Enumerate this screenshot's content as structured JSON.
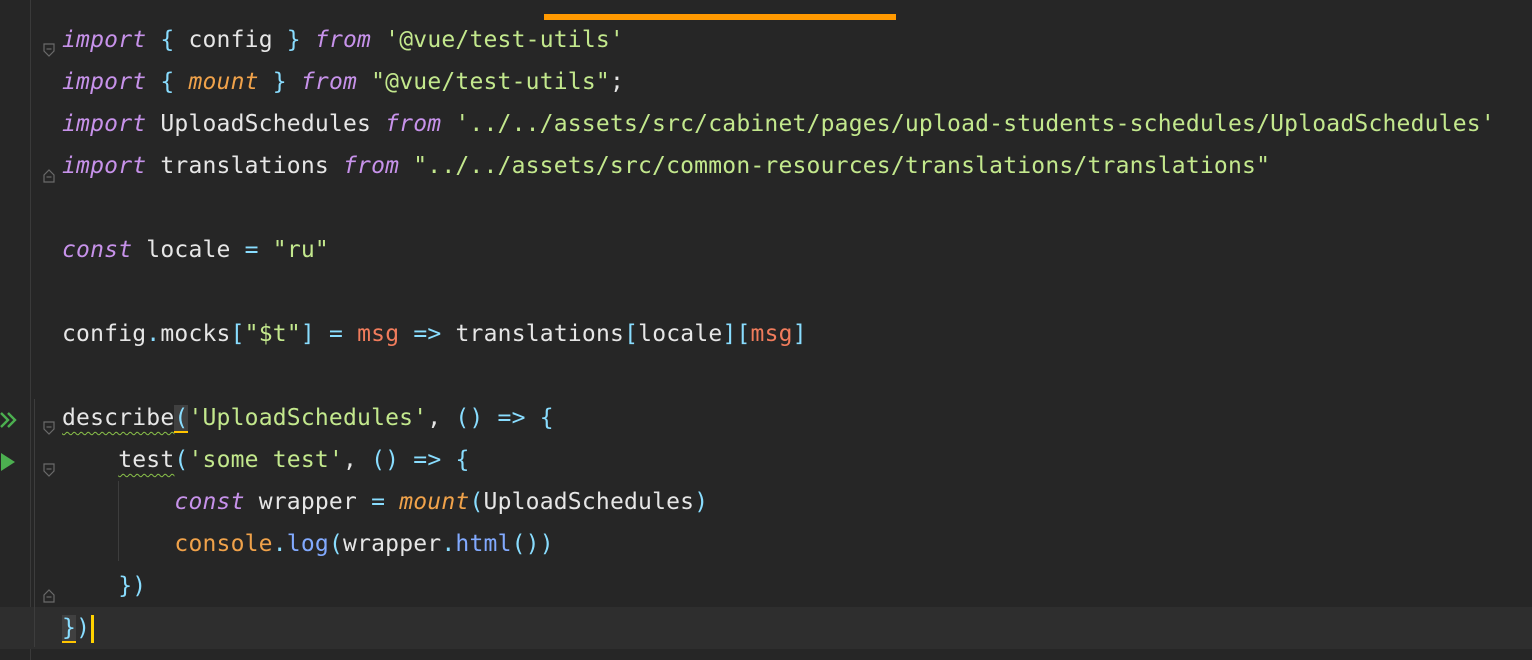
{
  "editor": {
    "language": "javascript",
    "lines": [
      {
        "tokens": [
          {
            "t": "import",
            "c": "kw"
          },
          {
            "t": " { ",
            "c": "punc"
          },
          {
            "t": "config",
            "c": "ident"
          },
          {
            "t": " } ",
            "c": "punc"
          },
          {
            "t": "from",
            "c": "kw"
          },
          {
            "t": " ",
            "c": "ident"
          },
          {
            "t": "'@vue/test-utils'",
            "c": "str"
          }
        ]
      },
      {
        "tokens": [
          {
            "t": "import",
            "c": "kw"
          },
          {
            "t": " { ",
            "c": "punc"
          },
          {
            "t": "mount",
            "c": "fn-it"
          },
          {
            "t": " } ",
            "c": "punc"
          },
          {
            "t": "from",
            "c": "kw"
          },
          {
            "t": " ",
            "c": "ident"
          },
          {
            "t": "\"@vue/test-utils\"",
            "c": "str"
          },
          {
            "t": ";",
            "c": "ident"
          }
        ]
      },
      {
        "tokens": [
          {
            "t": "import",
            "c": "kw"
          },
          {
            "t": " UploadSchedules ",
            "c": "ident"
          },
          {
            "t": "from",
            "c": "kw"
          },
          {
            "t": " ",
            "c": "ident"
          },
          {
            "t": "'../../assets/src/cabinet/pages/upload-students-schedules/UploadSchedules'",
            "c": "str"
          }
        ]
      },
      {
        "tokens": [
          {
            "t": "import",
            "c": "kw"
          },
          {
            "t": " translations ",
            "c": "ident"
          },
          {
            "t": "from",
            "c": "kw"
          },
          {
            "t": " ",
            "c": "ident"
          },
          {
            "t": "\"../../assets/src/common-resources/translations/translations\"",
            "c": "str"
          }
        ]
      },
      {
        "tokens": []
      },
      {
        "tokens": [
          {
            "t": "const",
            "c": "kw"
          },
          {
            "t": " locale ",
            "c": "ident"
          },
          {
            "t": "=",
            "c": "punc"
          },
          {
            "t": " ",
            "c": "ident"
          },
          {
            "t": "\"ru\"",
            "c": "str"
          }
        ]
      },
      {
        "tokens": []
      },
      {
        "tokens": [
          {
            "t": "config",
            "c": "ident"
          },
          {
            "t": ".",
            "c": "punc"
          },
          {
            "t": "mocks",
            "c": "ident"
          },
          {
            "t": "[",
            "c": "punc"
          },
          {
            "t": "\"$t\"",
            "c": "str"
          },
          {
            "t": "]",
            "c": "punc"
          },
          {
            "t": " ",
            "c": "ident"
          },
          {
            "t": "=",
            "c": "punc"
          },
          {
            "t": " ",
            "c": "ident"
          },
          {
            "t": "msg",
            "c": "param"
          },
          {
            "t": " ",
            "c": "ident"
          },
          {
            "t": "=>",
            "c": "punc"
          },
          {
            "t": " translations",
            "c": "ident"
          },
          {
            "t": "[",
            "c": "punc"
          },
          {
            "t": "locale",
            "c": "ident"
          },
          {
            "t": "][",
            "c": "punc"
          },
          {
            "t": "msg",
            "c": "param"
          },
          {
            "t": "]",
            "c": "punc"
          }
        ]
      },
      {
        "tokens": []
      },
      {
        "tokens": [
          {
            "t": "describe",
            "c": "ident warn-underline"
          },
          {
            "t": "(",
            "c": "punc bracket-hl"
          },
          {
            "t": "'UploadSchedules'",
            "c": "str"
          },
          {
            "t": ", ",
            "c": "ident"
          },
          {
            "t": "()",
            "c": "punc"
          },
          {
            "t": " ",
            "c": "ident"
          },
          {
            "t": "=>",
            "c": "punc"
          },
          {
            "t": " ",
            "c": "ident"
          },
          {
            "t": "{",
            "c": "punc"
          }
        ]
      },
      {
        "tokens": [
          {
            "t": "    ",
            "c": "ident"
          },
          {
            "t": "test",
            "c": "ident warn-underline"
          },
          {
            "t": "(",
            "c": "punc"
          },
          {
            "t": "'some test'",
            "c": "str"
          },
          {
            "t": ", ",
            "c": "ident"
          },
          {
            "t": "()",
            "c": "punc"
          },
          {
            "t": " ",
            "c": "ident"
          },
          {
            "t": "=>",
            "c": "punc"
          },
          {
            "t": " ",
            "c": "ident"
          },
          {
            "t": "{",
            "c": "punc"
          }
        ]
      },
      {
        "tokens": [
          {
            "t": "        ",
            "c": "ident"
          },
          {
            "t": "const",
            "c": "kw"
          },
          {
            "t": " wrapper ",
            "c": "ident"
          },
          {
            "t": "=",
            "c": "punc"
          },
          {
            "t": " ",
            "c": "ident"
          },
          {
            "t": "mount",
            "c": "fn-it"
          },
          {
            "t": "(",
            "c": "punc"
          },
          {
            "t": "UploadSchedules",
            "c": "ident"
          },
          {
            "t": ")",
            "c": "punc"
          }
        ]
      },
      {
        "tokens": [
          {
            "t": "        ",
            "c": "ident"
          },
          {
            "t": "console",
            "c": "obj"
          },
          {
            "t": ".",
            "c": "punc"
          },
          {
            "t": "log",
            "c": "method"
          },
          {
            "t": "(",
            "c": "punc"
          },
          {
            "t": "wrapper",
            "c": "ident"
          },
          {
            "t": ".",
            "c": "punc"
          },
          {
            "t": "html",
            "c": "method"
          },
          {
            "t": "())",
            "c": "punc"
          }
        ]
      },
      {
        "tokens": [
          {
            "t": "    ",
            "c": "ident"
          },
          {
            "t": "})",
            "c": "punc"
          }
        ]
      },
      {
        "tokens": [
          {
            "t": "}",
            "c": "punc bracket-hl"
          },
          {
            "t": ")",
            "c": "punc"
          }
        ],
        "current": true,
        "caret": true
      }
    ],
    "run_markers": [
      {
        "line": 9,
        "icon": "run-all-tests-icon"
      },
      {
        "line": 10,
        "icon": "run-test-icon"
      }
    ],
    "fold_markers": [
      {
        "line": 0,
        "icon": "fold-open-icon"
      },
      {
        "line": 3,
        "icon": "fold-close-icon"
      },
      {
        "line": 9,
        "icon": "fold-open-icon"
      },
      {
        "line": 10,
        "icon": "fold-open-icon"
      },
      {
        "line": 13,
        "icon": "fold-close-icon"
      },
      {
        "line": 14,
        "icon": "fold-close-icon"
      }
    ],
    "colors": {
      "background": "#262626",
      "accent_tab": "#ff9900",
      "caret": "#ffd200",
      "run_marker": "#4caf50"
    }
  }
}
